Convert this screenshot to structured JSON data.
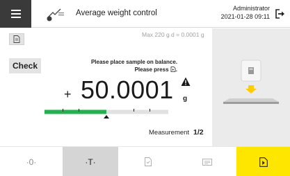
{
  "header": {
    "menu_icon": "hamburger-icon",
    "task_icon": "balance-task-icon",
    "title": "Average weight control",
    "user": "Administrator",
    "datetime": "2021-01-28  09:11",
    "logout_icon": "logout-icon"
  },
  "main": {
    "protocol_icon": "document-icon",
    "capacity_info": "Max 220 g    d = 0.0001 g",
    "check_label": "Check",
    "instruction_line1": "Please place sample on balance.",
    "instruction_line2": "Please press",
    "instruction_icon": "accept-icon",
    "sign": "+",
    "weight_value": "50.0001",
    "unit": "g",
    "warning_icon": "warning-icon",
    "tolerance_bar": {
      "fill_fraction": 0.5,
      "accent_color": "#22b14c"
    },
    "measurement_label": "Measurement",
    "measurement_count": "1/2"
  },
  "side_panel": {
    "illustration": "place-weight-on-pan-icon",
    "arrow_color": "#ffcc00"
  },
  "toolbar": {
    "zero_label": "·0·",
    "tare_label": "·T·",
    "button3_icon": "document-check-icon",
    "button4_icon": "id-card-icon",
    "accept_icon": "accept-icon",
    "accept_color": "#ffe600"
  }
}
